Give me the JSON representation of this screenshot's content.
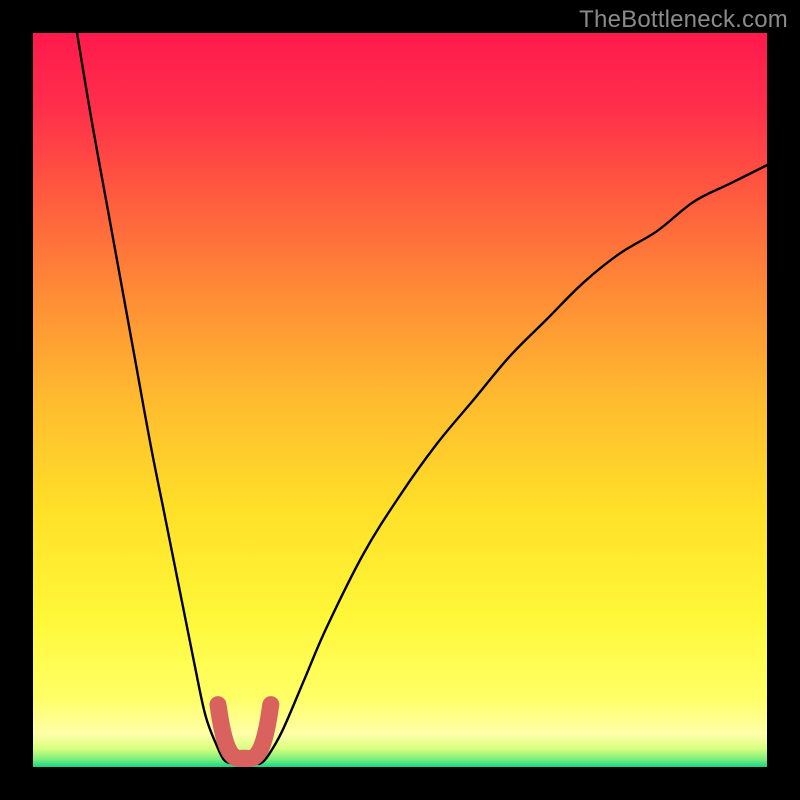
{
  "watermark": "TheBottleneck.com",
  "chart_data": {
    "type": "line",
    "title": "",
    "xlabel": "",
    "ylabel": "",
    "xlim": [
      0,
      100
    ],
    "ylim": [
      0,
      100
    ],
    "grid": false,
    "series": [
      {
        "name": "curve-left",
        "x": [
          6,
          8,
          10,
          12,
          14,
          16,
          18,
          20,
          22,
          23.5,
          25,
          26,
          27,
          27.5
        ],
        "y": [
          100,
          88,
          77,
          66,
          55,
          44,
          34,
          24,
          14,
          7,
          3,
          1,
          0.5,
          0.5
        ]
      },
      {
        "name": "curve-right",
        "x": [
          30.5,
          31,
          32,
          34,
          37,
          40,
          45,
          50,
          55,
          60,
          65,
          70,
          75,
          80,
          85,
          90,
          95,
          100
        ],
        "y": [
          0.5,
          0.5,
          1.5,
          5,
          12,
          19,
          29,
          37,
          44,
          50,
          56,
          61,
          66,
          70,
          73,
          77,
          79.5,
          82
        ]
      },
      {
        "name": "u-segment",
        "x": [
          25.2,
          25.7,
          26.3,
          27.0,
          27.8,
          28.8,
          29.8,
          30.6,
          31.3,
          31.9,
          32.4
        ],
        "y": [
          8.5,
          5.5,
          3.2,
          1.8,
          1.2,
          1.2,
          1.2,
          1.8,
          3.2,
          5.5,
          8.5
        ]
      }
    ],
    "gradient_stops": [
      {
        "offset": 0.0,
        "color": "#ff1a4c"
      },
      {
        "offset": 0.1,
        "color": "#ff2e4b"
      },
      {
        "offset": 0.22,
        "color": "#ff5a3f"
      },
      {
        "offset": 0.35,
        "color": "#ff8a36"
      },
      {
        "offset": 0.5,
        "color": "#ffbb2f"
      },
      {
        "offset": 0.65,
        "color": "#ffe028"
      },
      {
        "offset": 0.8,
        "color": "#fff83a"
      },
      {
        "offset": 0.905,
        "color": "#ffff66"
      },
      {
        "offset": 0.955,
        "color": "#ffffa8"
      },
      {
        "offset": 0.975,
        "color": "#d8ff80"
      },
      {
        "offset": 0.99,
        "color": "#78ee7a"
      },
      {
        "offset": 1.0,
        "color": "#12d68a"
      }
    ],
    "curve_color": "#000000",
    "u_color": "#d9625f"
  }
}
